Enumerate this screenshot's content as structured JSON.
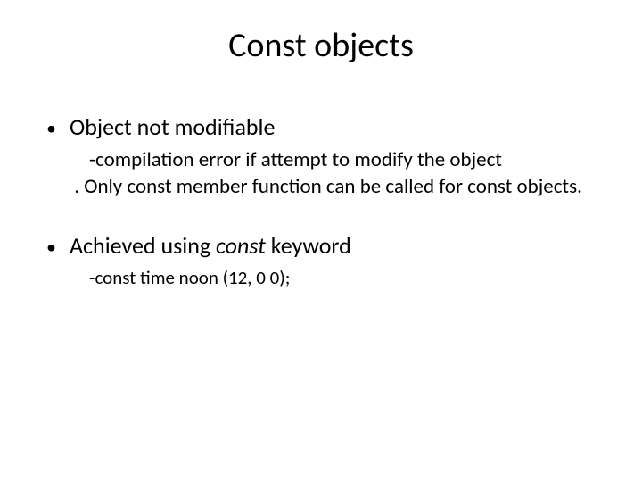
{
  "title": "Const objects",
  "bullets": [
    {
      "text": "Object not modifiable",
      "sub": {
        "dash": "-",
        "line1_rest": "compilation error if attempt to modify the object",
        "line2": "      . Only const member function can be called for const objects."
      }
    },
    {
      "text_before": "Achieved using ",
      "italic": "const",
      "text_after": " keyword",
      "sub2": {
        "dash": "-",
        "rest": "const time noon (12, 0 0);"
      }
    }
  ]
}
